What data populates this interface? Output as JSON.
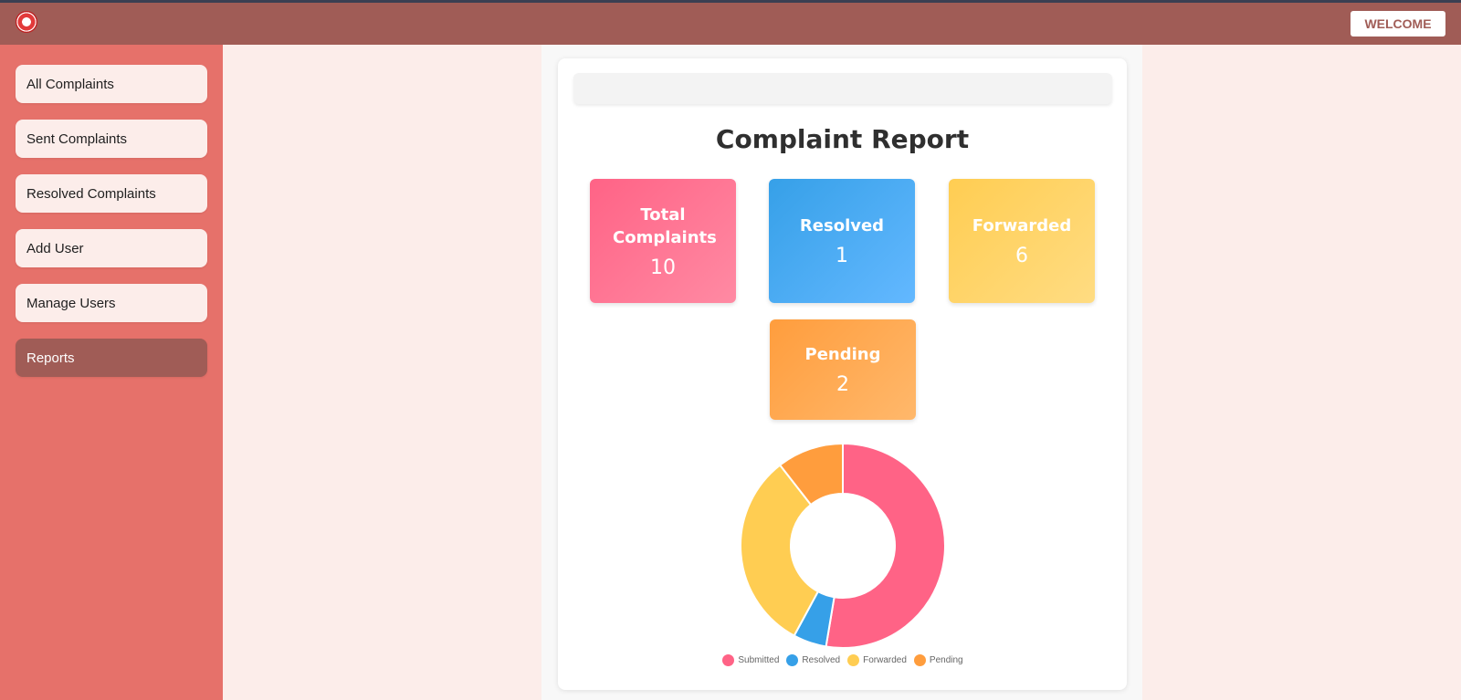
{
  "header": {
    "logo_icon": "railway-logo-icon",
    "welcome_label": "WELCOME"
  },
  "sidebar": {
    "items": [
      {
        "label": "All Complaints",
        "active": false
      },
      {
        "label": "Sent Complaints",
        "active": false
      },
      {
        "label": "Resolved Complaints",
        "active": false
      },
      {
        "label": "Add User",
        "active": false
      },
      {
        "label": "Manage Users",
        "active": false
      },
      {
        "label": "Reports",
        "active": true
      }
    ]
  },
  "report": {
    "title": "Complaint Report",
    "stats": {
      "total": {
        "label": "Total Complaints",
        "value": "10",
        "color": "#ff6386"
      },
      "resolved": {
        "label": "Resolved",
        "value": "1",
        "color": "#36a0e8"
      },
      "forwarded": {
        "label": "Forwarded",
        "value": "6",
        "color": "#ffcd52"
      },
      "pending": {
        "label": "Pending",
        "value": "2",
        "color": "#ff9d3d"
      }
    }
  },
  "colors": {
    "header": "#a05c56",
    "sidebar": "#e6716a",
    "background": "#fcedea"
  },
  "chart_data": {
    "type": "pie",
    "donut": true,
    "categories": [
      "Submitted",
      "Resolved",
      "Forwarded",
      "Pending"
    ],
    "values": [
      10,
      1,
      6,
      2
    ],
    "colors": [
      "#ff6386",
      "#36a0e8",
      "#ffcd52",
      "#ff9d3d"
    ],
    "legend": "bottom",
    "title": ""
  }
}
